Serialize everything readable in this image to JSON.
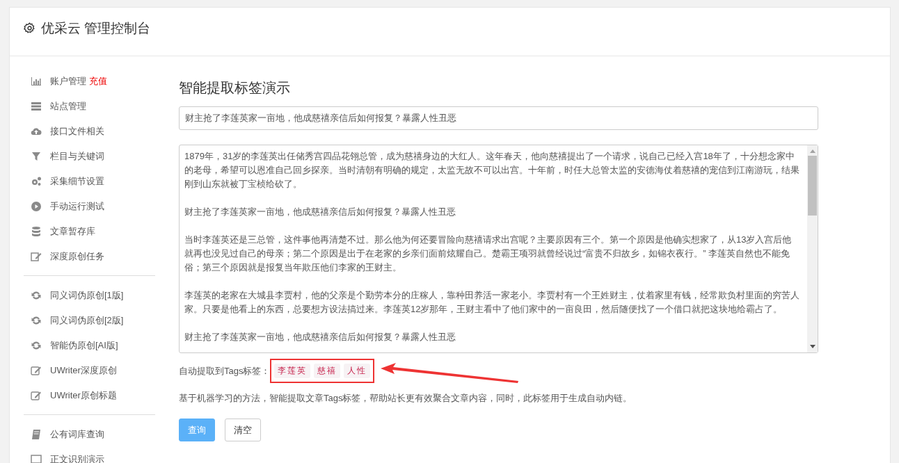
{
  "header": {
    "title": "优采云 管理控制台"
  },
  "sidebar": {
    "groups": [
      {
        "items": [
          {
            "label": "账户管理",
            "badge": "充值"
          },
          {
            "label": "站点管理"
          },
          {
            "label": "接口文件相关"
          },
          {
            "label": "栏目与关键词"
          },
          {
            "label": "采集细节设置"
          },
          {
            "label": "手动运行测试"
          },
          {
            "label": "文章暂存库"
          },
          {
            "label": "深度原创任务"
          }
        ]
      },
      {
        "items": [
          {
            "label": "同义词伪原创[1版]"
          },
          {
            "label": "同义词伪原创[2版]"
          },
          {
            "label": "智能伪原创[AI版]"
          },
          {
            "label": "UWriter深度原创"
          },
          {
            "label": "UWriter原创标题"
          }
        ]
      },
      {
        "items": [
          {
            "label": "公有词库查询"
          },
          {
            "label": "正文识别演示"
          }
        ]
      }
    ]
  },
  "main": {
    "title": "智能提取标签演示",
    "title_field": {
      "value": "财主抢了李莲英家一亩地，他成慈禧亲信后如何报复？暴露人性丑恶"
    },
    "article_field": {
      "paragraphs": [
        "1879年，31岁的李莲英出任储秀宫四品花翎总管，成为慈禧身边的大红人。这年春天，他向慈禧提出了一个请求，说自己已经入宫18年了，十分想念家中的老母，希望可以恩准自己回乡探亲。当时清朝有明确的规定，太监无故不可以出宫。十年前，时任大总管太监的安德海仗着慈禧的宠信到江南游玩，结果刚到山东就被丁宝桢给砍了。",
        "财主抢了李莲英家一亩地，他成慈禧亲信后如何报复？暴露人性丑恶",
        "当时李莲英还是三总管，这件事他再清楚不过。那么他为何还要冒险向慈禧请求出宫呢？主要原因有三个。第一个原因是他确实想家了，从13岁入宫后他就再也没见过自己的母亲；第二个原因是出于在老家的乡亲们面前炫耀自己。楚霸王项羽就曾经说过“富贵不归故乡，如锦衣夜行。” 李莲英自然也不能免俗；第三个原因就是报复当年欺压他们李家的王财主。",
        "李莲英的老家在大城县李贾村，他的父亲是个勤劳本分的庄稼人，靠种田养活一家老小。李贾村有一个王姓财主，仗着家里有钱，经常欺负村里面的穷苦人家。只要是他看上的东西，总要想方设法搞过来。李莲英12岁那年，王财主看中了他们家中的一亩良田，然后随便找了一个借口就把这块地给霸占了。",
        "财主抢了李莲英家一亩地，他成慈禧亲信后如何报复？暴露人性丑恶"
      ]
    },
    "tags": {
      "label": "自动提取到Tags标签：",
      "items": [
        "李莲英",
        "慈禧",
        "人性"
      ],
      "highlighted": true
    },
    "description": "基于机器学习的方法，智能提取文章Tags标签，帮助站长更有效聚合文章内容，同时，此标签用于生成自动内链。",
    "buttons": [
      {
        "label": "查询",
        "kind": "primary"
      },
      {
        "label": "清空",
        "kind": "default"
      }
    ]
  }
}
